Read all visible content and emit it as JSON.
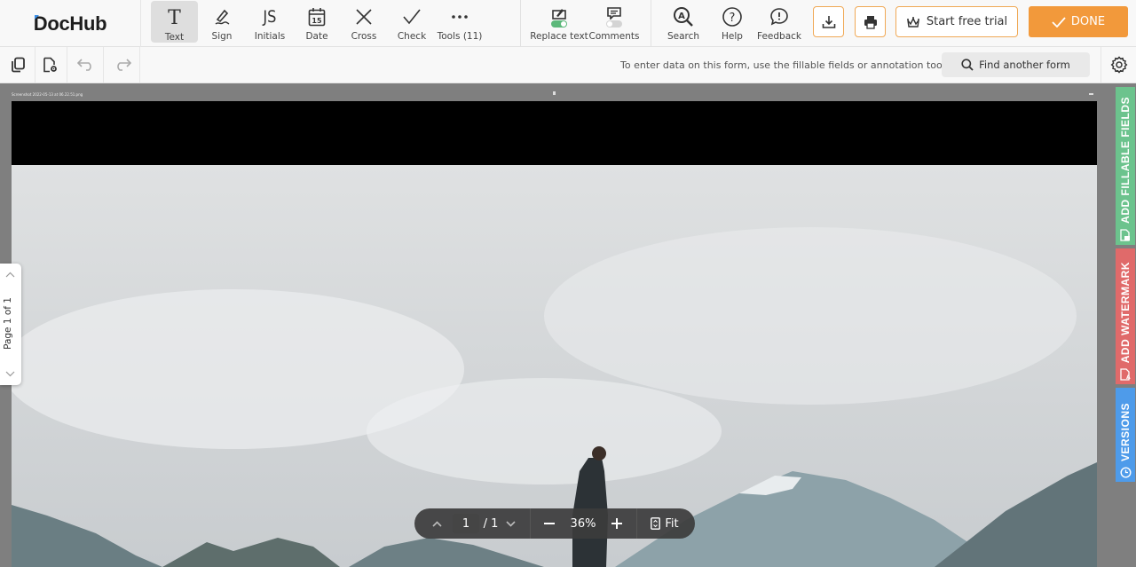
{
  "app": {
    "logo": "DocHub"
  },
  "toolbar": {
    "tools": [
      {
        "label": "Text",
        "icon": "text-icon",
        "active": true
      },
      {
        "label": "Sign",
        "icon": "sign-icon"
      },
      {
        "label": "Initials",
        "icon": "initials-icon",
        "glyph": "JS"
      },
      {
        "label": "Date",
        "icon": "calendar-icon",
        "glyph": "15"
      },
      {
        "label": "Cross",
        "icon": "cross-icon"
      },
      {
        "label": "Check",
        "icon": "check-icon"
      },
      {
        "label": "Tools (11)",
        "icon": "more-icon"
      }
    ],
    "replace_text": {
      "label": "Replace text",
      "toggle_on": true
    },
    "comments": {
      "label": "Comments",
      "toggle_on": false
    },
    "search_label": "Search",
    "help_label": "Help",
    "feedback_label": "Feedback",
    "trial_label": "Start free trial",
    "done_label": "DONE",
    "accent": "#f2993b"
  },
  "subbar": {
    "hint": "To enter data on this form, use the fillable fields or annotation tools.",
    "find_label": "Find another form"
  },
  "document": {
    "filename": "Screenshot 2022-05-13 at 06.22.51.png"
  },
  "side_tabs": [
    {
      "label": "ADD FILLABLE FIELDS",
      "color": "#6cc38d",
      "icon": "fillable-fields-icon"
    },
    {
      "label": "ADD WATERMARK",
      "color": "#e06a6a",
      "icon": "watermark-icon"
    },
    {
      "label": "VERSIONS",
      "color": "#4e9bea",
      "icon": "clock-icon"
    }
  ],
  "left_pager": {
    "label": "Page 1 of 1"
  },
  "zoombar": {
    "current_page": "1",
    "total_pages": "/ 1",
    "zoom": "36%",
    "fit_label": "Fit"
  }
}
